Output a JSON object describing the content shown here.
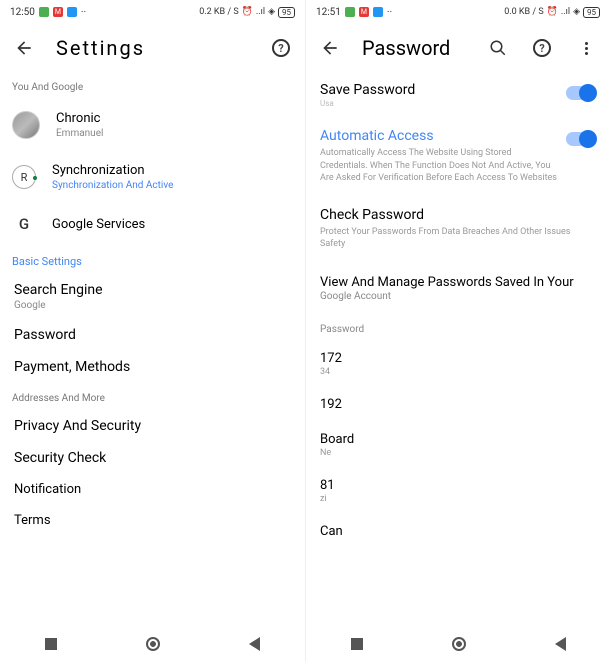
{
  "left": {
    "status": {
      "time": "12:50",
      "net": "0.2 KB / S",
      "battery": "95"
    },
    "title": "Settings",
    "section_you": "You And Google",
    "profile": {
      "name": "Chronic",
      "user": "Emmanuel"
    },
    "sync": {
      "title": "Synchronization",
      "sub": "Synchronization And Active"
    },
    "services": "Google Services",
    "section_basic": "Basic Settings",
    "search_engine": {
      "title": "Search Engine",
      "value": "Google"
    },
    "password": "Password",
    "payment": "Payment, Methods",
    "addresses": "Addresses And More",
    "privacy": "Privacy And Security",
    "security_check": "Security Check",
    "notification": "Notification",
    "terms": "Terms"
  },
  "right": {
    "status": {
      "time": "12:51",
      "net": "0.0 KB / S",
      "battery": "95"
    },
    "title": "Password",
    "save": {
      "title": "Save Password",
      "sub": "Usa"
    },
    "auto": {
      "title": "Automatic Access",
      "desc": "Automatically Access The Website Using Stored Credentials. When The Function Does Not And Active, You Are Asked For Verification Before Each Access To Websites"
    },
    "check": {
      "title": "Check Password",
      "desc": "Protect Your Passwords From Data Breaches And Other Issues Safety"
    },
    "view": {
      "title": "View And Manage Passwords Saved In Your",
      "sub": "Google Account"
    },
    "pw_label": "Password",
    "items": [
      {
        "t": "172",
        "s": "34"
      },
      {
        "t": "192",
        "s": ""
      },
      {
        "t": "Board",
        "s": "Ne"
      },
      {
        "t": "81",
        "s": "zi"
      },
      {
        "t": "Can",
        "s": ""
      }
    ]
  }
}
